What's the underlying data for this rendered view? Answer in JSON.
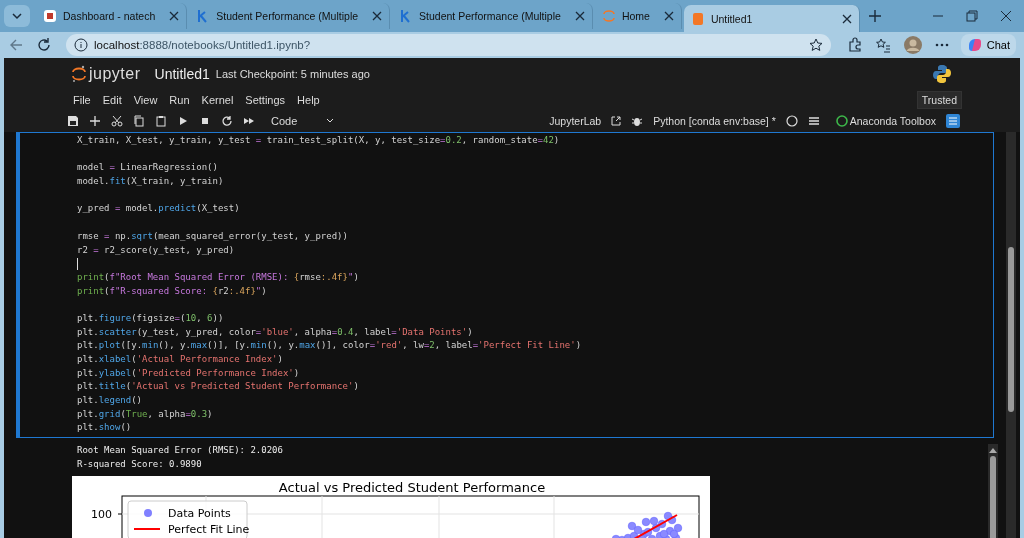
{
  "browser": {
    "tabs": [
      {
        "title": "Dashboard - natech",
        "kind": "dashboard",
        "selected": false
      },
      {
        "title": "Student Performance (Multiple",
        "kind": "k",
        "selected": false
      },
      {
        "title": "Student Performance (Multiple",
        "kind": "k",
        "selected": false
      },
      {
        "title": "Home",
        "kind": "jupyter",
        "selected": false
      },
      {
        "title": "Untitled1",
        "kind": "notebook",
        "selected": true
      }
    ],
    "address": {
      "host": "localhost",
      "path": ":8888/notebooks/Untitled1.ipynb?"
    },
    "chat_label": "Chat"
  },
  "notebook": {
    "brand": "jupyter",
    "title": "Untitled1",
    "checkpoint": "Last Checkpoint: 5 minutes ago",
    "menu": [
      "File",
      "Edit",
      "View",
      "Run",
      "Kernel",
      "Settings",
      "Help"
    ],
    "trusted": "Trusted",
    "cell_type": "Code",
    "jupyterlab_link": "JupyterLab",
    "kernel": "Python [conda env:base] *",
    "toolbox": "Anaconda Toolbox"
  },
  "code_cell": {
    "blocks": [
      {
        "cursor_after": false,
        "lines": [
          [
            {
              "kind": "name",
              "text": "X_train, X_test, y_train, y_test "
            },
            {
              "kind": "op",
              "text": "="
            },
            {
              "kind": "name",
              "text": " train_test_split(X, y, test_size"
            },
            {
              "kind": "op",
              "text": "="
            },
            {
              "kind": "number",
              "text": "0.2"
            },
            {
              "kind": "name",
              "text": ", random_state"
            },
            {
              "kind": "op",
              "text": "="
            },
            {
              "kind": "number",
              "text": "42"
            },
            {
              "kind": "name",
              "text": ")"
            }
          ]
        ]
      },
      {
        "cursor_after": false,
        "lines": [
          [
            {
              "kind": "name",
              "text": "model "
            },
            {
              "kind": "op",
              "text": "="
            },
            {
              "kind": "name",
              "text": " LinearRegression()"
            }
          ],
          [
            {
              "kind": "name",
              "text": "model."
            },
            {
              "kind": "func",
              "text": "fit"
            },
            {
              "kind": "name",
              "text": "(X_train, y_train)"
            }
          ]
        ]
      },
      {
        "cursor_after": false,
        "lines": [
          [
            {
              "kind": "name",
              "text": "y_pred "
            },
            {
              "kind": "op",
              "text": "="
            },
            {
              "kind": "name",
              "text": " model."
            },
            {
              "kind": "func",
              "text": "predict"
            },
            {
              "kind": "name",
              "text": "(X_test)"
            }
          ]
        ]
      },
      {
        "cursor_after": true,
        "lines": [
          [
            {
              "kind": "name",
              "text": "rmse "
            },
            {
              "kind": "op",
              "text": "="
            },
            {
              "kind": "name",
              "text": " np."
            },
            {
              "kind": "func",
              "text": "sqrt"
            },
            {
              "kind": "name",
              "text": "(mean_squared_error(y_test, y_pred))"
            }
          ],
          [
            {
              "kind": "name",
              "text": "r2 "
            },
            {
              "kind": "op",
              "text": "="
            },
            {
              "kind": "name",
              "text": " r2_score(y_test, y_pred)"
            }
          ]
        ]
      },
      {
        "cursor_after": false,
        "lines": [
          [
            {
              "kind": "builtin",
              "text": "print"
            },
            {
              "kind": "name",
              "text": "("
            },
            {
              "kind": "fstring",
              "text": "f\"Root Mean Squared Error (RMSE): "
            },
            {
              "kind": "brace",
              "text": "{"
            },
            {
              "kind": "name",
              "text": "rmse"
            },
            {
              "kind": "brace",
              "text": ":.4f}"
            },
            {
              "kind": "fstring",
              "text": "\""
            },
            {
              "kind": "name",
              "text": ")"
            }
          ],
          [
            {
              "kind": "builtin",
              "text": "print"
            },
            {
              "kind": "name",
              "text": "("
            },
            {
              "kind": "fstring",
              "text": "f\"R-squared Score: "
            },
            {
              "kind": "brace",
              "text": "{"
            },
            {
              "kind": "name",
              "text": "r2"
            },
            {
              "kind": "brace",
              "text": ":.4f}"
            },
            {
              "kind": "fstring",
              "text": "\""
            },
            {
              "kind": "name",
              "text": ")"
            }
          ]
        ]
      },
      {
        "cursor_after": false,
        "lines": [
          [
            {
              "kind": "name",
              "text": "plt."
            },
            {
              "kind": "func",
              "text": "figure"
            },
            {
              "kind": "name",
              "text": "(figsize"
            },
            {
              "kind": "op",
              "text": "="
            },
            {
              "kind": "name",
              "text": "("
            },
            {
              "kind": "number",
              "text": "10"
            },
            {
              "kind": "name",
              "text": ", "
            },
            {
              "kind": "number",
              "text": "6"
            },
            {
              "kind": "name",
              "text": "))"
            }
          ],
          [
            {
              "kind": "name",
              "text": "plt."
            },
            {
              "kind": "func",
              "text": "scatter"
            },
            {
              "kind": "name",
              "text": "(y_test, y_pred, color"
            },
            {
              "kind": "op",
              "text": "="
            },
            {
              "kind": "string",
              "text": "'blue'"
            },
            {
              "kind": "name",
              "text": ", alpha"
            },
            {
              "kind": "op",
              "text": "="
            },
            {
              "kind": "number",
              "text": "0.4"
            },
            {
              "kind": "name",
              "text": ", label"
            },
            {
              "kind": "op",
              "text": "="
            },
            {
              "kind": "string",
              "text": "'Data Points'"
            },
            {
              "kind": "name",
              "text": ")"
            }
          ],
          [
            {
              "kind": "name",
              "text": "plt."
            },
            {
              "kind": "func",
              "text": "plot"
            },
            {
              "kind": "name",
              "text": "([y."
            },
            {
              "kind": "func",
              "text": "min"
            },
            {
              "kind": "name",
              "text": "(), y."
            },
            {
              "kind": "func",
              "text": "max"
            },
            {
              "kind": "name",
              "text": "()], [y."
            },
            {
              "kind": "func",
              "text": "min"
            },
            {
              "kind": "name",
              "text": "(), y."
            },
            {
              "kind": "func",
              "text": "max"
            },
            {
              "kind": "name",
              "text": "()], color"
            },
            {
              "kind": "op",
              "text": "="
            },
            {
              "kind": "string",
              "text": "'red'"
            },
            {
              "kind": "name",
              "text": ", lw"
            },
            {
              "kind": "op",
              "text": "="
            },
            {
              "kind": "number",
              "text": "2"
            },
            {
              "kind": "name",
              "text": ", label"
            },
            {
              "kind": "op",
              "text": "="
            },
            {
              "kind": "string",
              "text": "'Perfect Fit Line'"
            },
            {
              "kind": "name",
              "text": ")"
            }
          ],
          [
            {
              "kind": "name",
              "text": "plt."
            },
            {
              "kind": "func",
              "text": "xlabel"
            },
            {
              "kind": "name",
              "text": "("
            },
            {
              "kind": "string",
              "text": "'Actual Performance Index'"
            },
            {
              "kind": "name",
              "text": ")"
            }
          ],
          [
            {
              "kind": "name",
              "text": "plt."
            },
            {
              "kind": "func",
              "text": "ylabel"
            },
            {
              "kind": "name",
              "text": "("
            },
            {
              "kind": "string",
              "text": "'Predicted Performance Index'"
            },
            {
              "kind": "name",
              "text": ")"
            }
          ],
          [
            {
              "kind": "name",
              "text": "plt."
            },
            {
              "kind": "func",
              "text": "title"
            },
            {
              "kind": "name",
              "text": "("
            },
            {
              "kind": "string",
              "text": "'Actual vs Predicted Student Performance'"
            },
            {
              "kind": "name",
              "text": ")"
            }
          ],
          [
            {
              "kind": "name",
              "text": "plt."
            },
            {
              "kind": "func",
              "text": "legend"
            },
            {
              "kind": "name",
              "text": "()"
            }
          ],
          [
            {
              "kind": "name",
              "text": "plt."
            },
            {
              "kind": "func",
              "text": "grid"
            },
            {
              "kind": "name",
              "text": "("
            },
            {
              "kind": "builtin",
              "text": "True"
            },
            {
              "kind": "name",
              "text": ", alpha"
            },
            {
              "kind": "op",
              "text": "="
            },
            {
              "kind": "number",
              "text": "0.3"
            },
            {
              "kind": "name",
              "text": ")"
            }
          ],
          [
            {
              "kind": "name",
              "text": "plt."
            },
            {
              "kind": "func",
              "text": "show"
            },
            {
              "kind": "name",
              "text": "()"
            }
          ]
        ]
      }
    ]
  },
  "output": {
    "lines": [
      "Root Mean Squared Error (RMSE): 2.0206",
      "R-squared Score: 0.9890"
    ],
    "plot": {
      "title": "Actual vs Predicted Student Performance",
      "yticks": [
        "100"
      ],
      "legend": [
        {
          "label": "Data Points",
          "kind": "marker",
          "color": "#8080ff"
        },
        {
          "label": "Perfect Fit Line",
          "kind": "line",
          "color": "#ff0000"
        }
      ]
    }
  }
}
